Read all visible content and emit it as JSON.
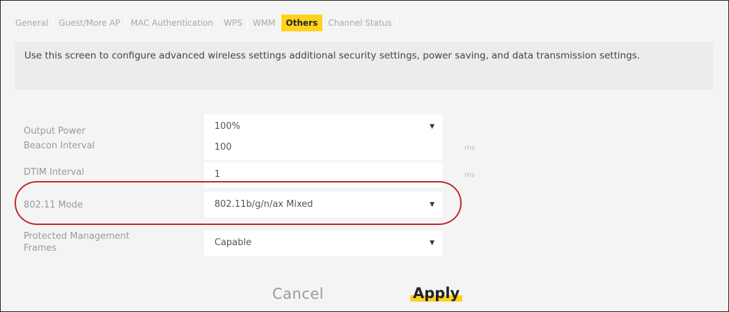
{
  "tabs": [
    {
      "label": "General"
    },
    {
      "label": "Guest/More AP"
    },
    {
      "label": "MAC Authentication"
    },
    {
      "label": "WPS"
    },
    {
      "label": "WMM"
    },
    {
      "label": "Others"
    },
    {
      "label": "Channel Status"
    }
  ],
  "description": "Use this screen to configure advanced wireless settings additional security settings, power saving, and data transmission settings.",
  "form": {
    "output_power": {
      "label": "Output Power",
      "value": "100%"
    },
    "beacon_interval": {
      "label": "Beacon Interval",
      "value": "100",
      "unit": "ms"
    },
    "dtim_interval": {
      "label": "DTIM Interval",
      "value": "1",
      "unit": "ms"
    },
    "mode_80211": {
      "label": "802.11 Mode",
      "value": "802.11b/g/n/ax Mixed"
    },
    "pmf": {
      "label": "Protected Management Frames",
      "value": "Capable"
    }
  },
  "buttons": {
    "cancel": "Cancel",
    "apply": "Apply"
  },
  "colors": {
    "accent": "#ffd21b",
    "highlight_ring": "#c2252b"
  }
}
